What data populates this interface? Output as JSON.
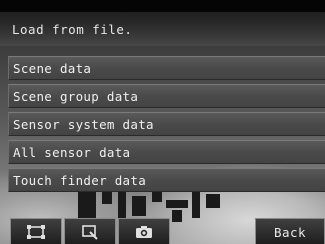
{
  "header": {
    "title": "Load from file."
  },
  "menu": {
    "items": [
      {
        "label": "Scene data"
      },
      {
        "label": "Scene group data"
      },
      {
        "label": "Sensor system data"
      },
      {
        "label": "All sensor data"
      },
      {
        "label": "Touch finder data"
      }
    ]
  },
  "footer": {
    "buttons": [
      {
        "icon": "frame-icon"
      },
      {
        "icon": "zoom-area-icon"
      },
      {
        "icon": "camera-icon"
      }
    ],
    "back_label": "Back"
  }
}
